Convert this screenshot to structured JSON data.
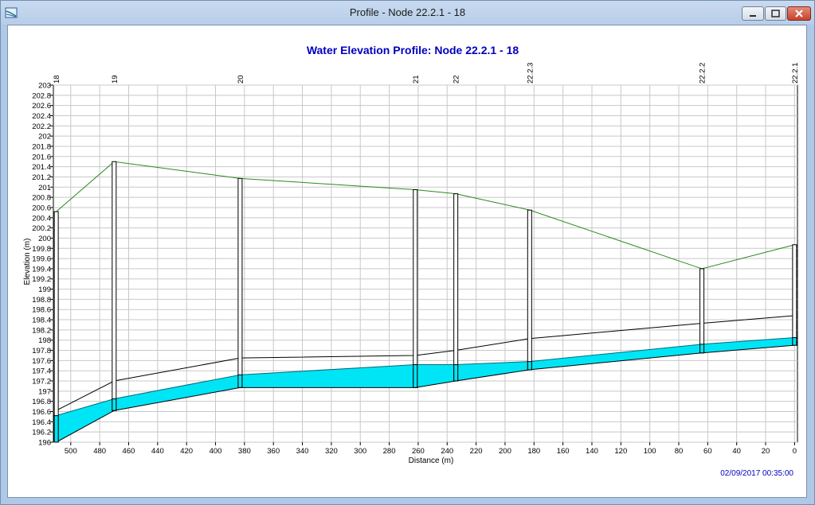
{
  "window": {
    "title": "Profile - Node 22.2.1 - 18",
    "controls": [
      "minimize-icon",
      "maximize-icon",
      "close-icon"
    ]
  },
  "colors": {
    "ground_line": "#2a8a1e",
    "water_fill": "#00e5f5",
    "title_color": "#0000c0",
    "timestamp_color": "#0000c0"
  },
  "chart_data": {
    "type": "area",
    "title": "Water Elevation Profile:  Node 22.2.1 - 18",
    "xlabel": "Distance (m)",
    "ylabel": "Elevation (m)",
    "x_reversed": true,
    "xlim": [
      512,
      -2
    ],
    "ylim": [
      196,
      203
    ],
    "x_ticks": [
      500,
      480,
      460,
      440,
      420,
      400,
      380,
      360,
      340,
      320,
      300,
      280,
      260,
      240,
      220,
      200,
      180,
      160,
      140,
      120,
      100,
      80,
      60,
      40,
      20,
      0
    ],
    "y_ticks": [
      "196",
      "196.2",
      "196.4",
      "196.6",
      "196.8",
      "197",
      "197.2",
      "197.4",
      "197.6",
      "197.8",
      "198",
      "198.2",
      "198.4",
      "198.6",
      "198.8",
      "199",
      "199.2",
      "199.4",
      "199.6",
      "199.8",
      "200",
      "200.2",
      "200.4",
      "200.6",
      "200.8",
      "201",
      "201.2",
      "201.4",
      "201.6",
      "201.8",
      "202",
      "202.2",
      "202.4",
      "202.6",
      "202.8",
      "203"
    ],
    "grid": true,
    "nodes": [
      {
        "name": "18",
        "x": 510,
        "ground": 200.52,
        "crown": 196.62,
        "water": 196.52,
        "invert": 196.0
      },
      {
        "name": "19",
        "x": 470,
        "ground": 201.5,
        "crown": 197.2,
        "water": 196.85,
        "invert": 196.62
      },
      {
        "name": "20",
        "x": 383,
        "ground": 201.17,
        "crown": 197.65,
        "water": 197.32,
        "invert": 197.07
      },
      {
        "name": "21",
        "x": 262,
        "ground": 200.95,
        "crown": 197.7,
        "water": 197.52,
        "invert": 197.07
      },
      {
        "name": "22",
        "x": 234,
        "ground": 200.87,
        "crown": 197.8,
        "water": 197.52,
        "invert": 197.2
      },
      {
        "name": "22.2.3",
        "x": 183,
        "ground": 200.55,
        "crown": 198.03,
        "water": 197.58,
        "invert": 197.42
      },
      {
        "name": "22.2.2",
        "x": 64,
        "ground": 199.4,
        "crown": 198.33,
        "water": 197.92,
        "invert": 197.75
      },
      {
        "name": "22.2.1",
        "x": 0,
        "ground": 199.87,
        "crown": 198.48,
        "water": 198.05,
        "invert": 197.9
      }
    ],
    "timestamp": "02/09/2017 00:35:00"
  }
}
